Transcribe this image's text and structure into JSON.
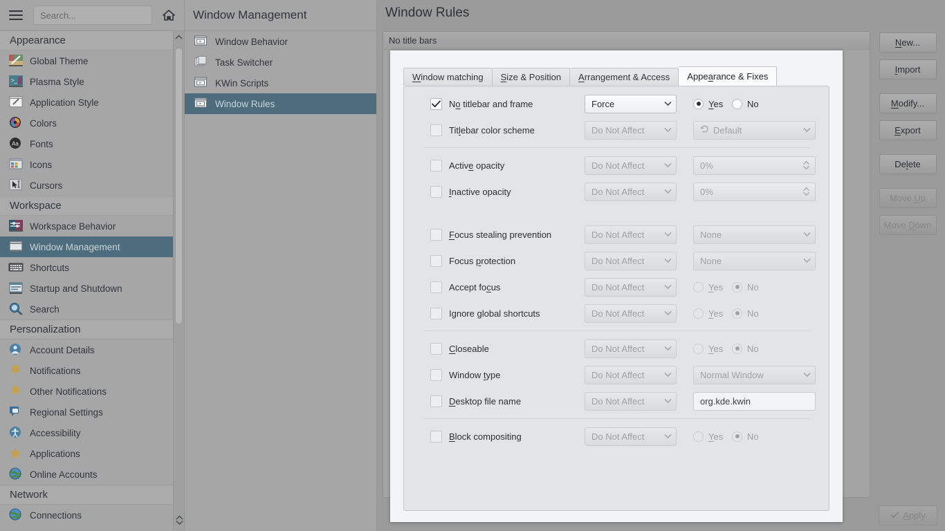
{
  "search": {
    "placeholder": "Search..."
  },
  "sidebar": {
    "groups": [
      {
        "title": "Appearance",
        "items": [
          {
            "label": "Global Theme",
            "icon": "global-theme-icon"
          },
          {
            "label": "Plasma Style",
            "icon": "plasma-style-icon"
          },
          {
            "label": "Application Style",
            "icon": "application-style-icon"
          },
          {
            "label": "Colors",
            "icon": "colors-icon"
          },
          {
            "label": "Fonts",
            "icon": "fonts-icon"
          },
          {
            "label": "Icons",
            "icon": "icons-icon"
          },
          {
            "label": "Cursors",
            "icon": "cursors-icon"
          }
        ]
      },
      {
        "title": "Workspace",
        "items": [
          {
            "label": "Workspace Behavior",
            "icon": "workspace-behavior-icon"
          },
          {
            "label": "Window Management",
            "icon": "window-management-icon",
            "selected": true
          },
          {
            "label": "Shortcuts",
            "icon": "shortcuts-icon"
          },
          {
            "label": "Startup and Shutdown",
            "icon": "startup-shutdown-icon"
          },
          {
            "label": "Search",
            "icon": "search-icon"
          }
        ]
      },
      {
        "title": "Personalization",
        "items": [
          {
            "label": "Account Details",
            "icon": "account-details-icon"
          },
          {
            "label": "Notifications",
            "icon": "notifications-icon"
          },
          {
            "label": "Other Notifications",
            "icon": "other-notifications-icon"
          },
          {
            "label": "Regional Settings",
            "icon": "regional-settings-icon"
          },
          {
            "label": "Accessibility",
            "icon": "accessibility-icon"
          },
          {
            "label": "Applications",
            "icon": "applications-icon"
          },
          {
            "label": "Online Accounts",
            "icon": "online-accounts-icon"
          }
        ]
      },
      {
        "title": "Network",
        "items": [
          {
            "label": "Connections",
            "icon": "connections-icon"
          }
        ]
      }
    ]
  },
  "subcategory": {
    "title": "Window Management",
    "items": [
      {
        "label": "Window Behavior",
        "icon": "window-behavior-icon"
      },
      {
        "label": "Task Switcher",
        "icon": "task-switcher-icon"
      },
      {
        "label": "KWin Scripts",
        "icon": "kwin-scripts-icon"
      },
      {
        "label": "Window Rules",
        "icon": "window-rules-icon",
        "selected": true
      }
    ]
  },
  "main": {
    "title": "Window Rules",
    "rules": [
      {
        "name": "No title bars"
      }
    ]
  },
  "dialog": {
    "tabs": [
      {
        "label": "Window matching",
        "accel": "W",
        "active": false
      },
      {
        "label": "Size & Position",
        "accel": "S",
        "active": false
      },
      {
        "label": "Arrangement & Access",
        "accel": "A",
        "active": false
      },
      {
        "label": "Appearance & Fixes",
        "accel": "a",
        "active": true
      }
    ],
    "rows": [
      {
        "id": "no-titlebar-and-frame",
        "label": "No titlebar and frame",
        "accel_index": 1,
        "checked": true,
        "enabled": true,
        "policy": "Force",
        "control": "radio",
        "radio": {
          "yes": "Yes",
          "no": "No",
          "selected": "yes"
        }
      },
      {
        "id": "titlebar-color-scheme",
        "label": "Titlebar color scheme",
        "accel_index": 3,
        "checked": false,
        "enabled": false,
        "policy": "Do Not Affect",
        "control": "select-revert",
        "value": "Default"
      },
      {
        "divider": true
      },
      {
        "id": "active-opacity",
        "label": "Active opacity",
        "accel_index": 5,
        "checked": false,
        "enabled": false,
        "policy": "Do Not Affect",
        "control": "spinbox",
        "value": "0%"
      },
      {
        "id": "inactive-opacity",
        "label": "Inactive opacity",
        "accel_index": 0,
        "checked": false,
        "enabled": false,
        "policy": "Do Not Affect",
        "control": "spinbox",
        "value": "0%"
      },
      {
        "bigspace": true
      },
      {
        "id": "focus-stealing-prevention",
        "label": "Focus stealing prevention",
        "accel_index": 0,
        "checked": false,
        "enabled": false,
        "policy": "Do Not Affect",
        "control": "select",
        "value": "None"
      },
      {
        "id": "focus-protection",
        "label": "Focus protection",
        "accel_index": 6,
        "checked": false,
        "enabled": false,
        "policy": "Do Not Affect",
        "control": "select",
        "value": "None"
      },
      {
        "id": "accept-focus",
        "label": "Accept focus",
        "accel_index": 9,
        "checked": false,
        "enabled": false,
        "policy": "Do Not Affect",
        "control": "radio",
        "radio": {
          "yes": "Yes",
          "no": "No",
          "selected": "no"
        }
      },
      {
        "id": "ignore-global-shortcuts",
        "label": "Ignore global shortcuts",
        "accel_index": 7,
        "checked": false,
        "enabled": false,
        "policy": "Do Not Affect",
        "control": "radio",
        "radio": {
          "yes": "Yes",
          "no": "No",
          "selected": "no"
        }
      },
      {
        "divider2": true
      },
      {
        "id": "closeable",
        "label": "Closeable",
        "accel_index": 0,
        "checked": false,
        "enabled": false,
        "policy": "Do Not Affect",
        "control": "radio",
        "radio": {
          "yes": "Yes",
          "no": "No",
          "selected": "no"
        }
      },
      {
        "id": "window-type",
        "label": "Window type",
        "accel_index": 7,
        "checked": false,
        "enabled": false,
        "policy": "Do Not Affect",
        "control": "select",
        "value": "Normal Window"
      },
      {
        "id": "desktop-file-name",
        "label": "Desktop file name",
        "accel_index": 0,
        "checked": false,
        "enabled": false,
        "policy": "Do Not Affect",
        "control": "text",
        "value": "org.kde.kwin"
      },
      {
        "divider3": true
      },
      {
        "id": "block-compositing",
        "label": "Block compositing",
        "accel_index": 0,
        "checked": false,
        "enabled": false,
        "policy": "Do Not Affect",
        "control": "radio",
        "radio": {
          "yes": "Yes",
          "no": "No",
          "selected": "no"
        }
      }
    ]
  },
  "actions": {
    "buttons": [
      {
        "label": "New...",
        "accel": "N",
        "enabled": true
      },
      {
        "label": "Import",
        "accel": "I",
        "enabled": true
      },
      {
        "sep": true
      },
      {
        "label": "Modify...",
        "accel": "M",
        "enabled": true
      },
      {
        "label": "Export",
        "accel": "E",
        "enabled": true
      },
      {
        "sep": true
      },
      {
        "label": "Delete",
        "accel": "l",
        "enabled": true
      },
      {
        "sep": true
      },
      {
        "label": "Move Up",
        "accel": "U",
        "enabled": false
      },
      {
        "label": "Move Down",
        "accel": "D",
        "enabled": false
      }
    ],
    "apply": {
      "label": "Apply",
      "icon": "check-icon",
      "enabled": false
    }
  },
  "colors": {
    "selection": "#4d6d7d",
    "window_bg": "#a6a6a6",
    "main_bg": "#9b9b9b",
    "panel_bg": "#e2e4e5",
    "dialog_bg": "#f3f4f5",
    "text": "#31363b",
    "disabled_text": "#9fa2a4"
  }
}
